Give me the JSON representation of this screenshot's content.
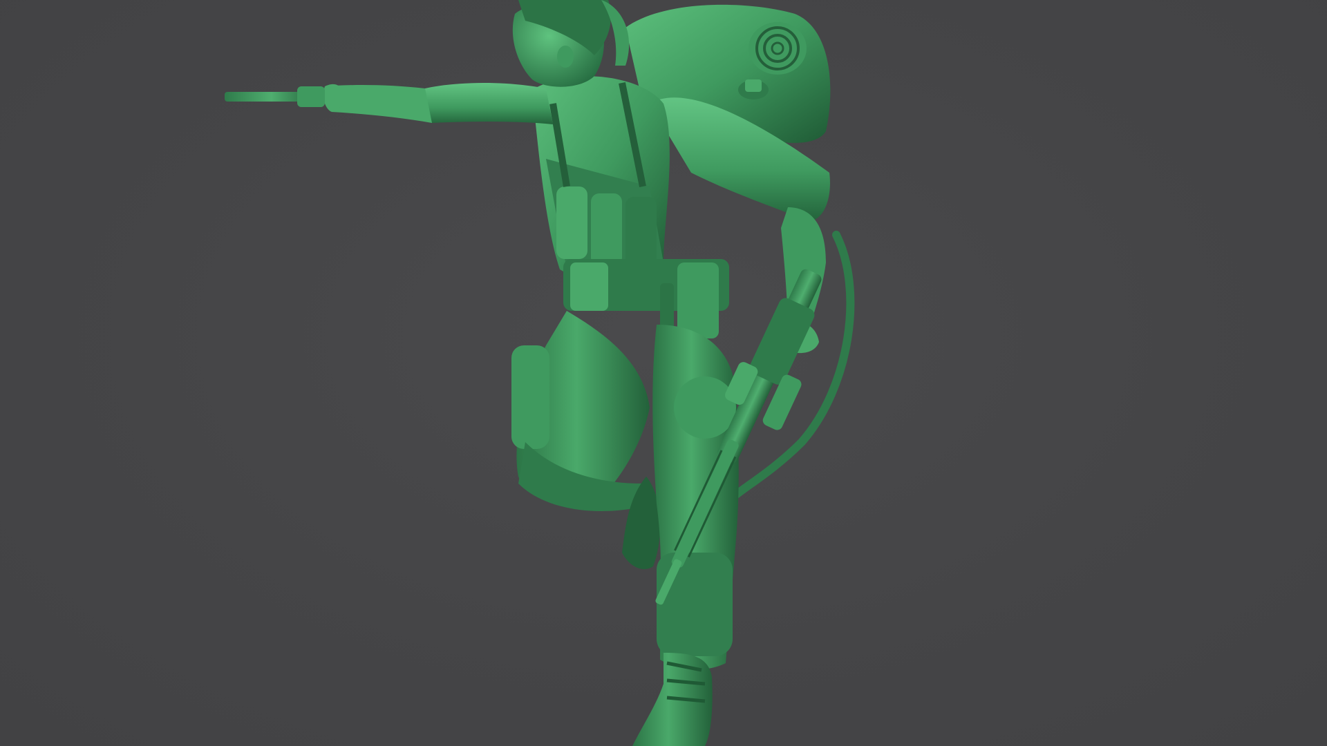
{
  "scene": {
    "subject": "green-plastic-army-soldier-figure",
    "colors": {
      "background": "#454547",
      "figure_base": "#3f9a5f",
      "figure_light": "#5cbf7c",
      "figure_shadow": "#1f5a35",
      "figure_deep": "#174428"
    }
  }
}
